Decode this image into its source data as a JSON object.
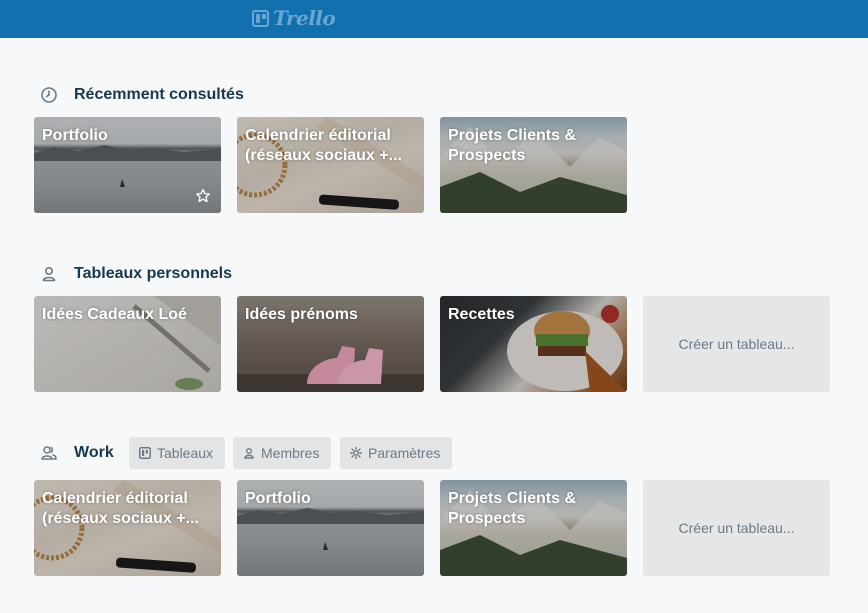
{
  "topbar": {
    "logo_text": "Trello"
  },
  "sections": {
    "recent": {
      "title": "Récemment consultés",
      "boards": [
        {
          "name": "Portfolio",
          "background": "lake"
        },
        {
          "name": "Calendrier éditorial (réseaux sociaux +...",
          "background": "desk"
        },
        {
          "name": "Projets Clients & Prospects",
          "background": "mountains"
        }
      ]
    },
    "personal": {
      "title": "Tableaux personnels",
      "boards": [
        {
          "name": "Idées Cadeaux Loé",
          "background": "paper"
        },
        {
          "name": "Idées prénoms",
          "background": "baby-shoes"
        },
        {
          "name": "Recettes",
          "background": "food"
        }
      ],
      "create_label": "Créer un tableau..."
    },
    "work": {
      "title": "Work",
      "tabs": {
        "boards": "Tableaux",
        "members": "Membres",
        "settings": "Paramètres"
      },
      "boards": [
        {
          "name": "Calendrier éditorial (réseaux sociaux +...",
          "background": "desk"
        },
        {
          "name": "Portfolio",
          "background": "lake"
        },
        {
          "name": "Projets Clients & Prospects",
          "background": "mountains"
        }
      ],
      "create_label": "Créer un tableau..."
    }
  },
  "colors": {
    "header": "#1170ad",
    "page_bg": "#f6f8f9",
    "section_title": "#17394d",
    "muted_text": "#6b7b87"
  }
}
